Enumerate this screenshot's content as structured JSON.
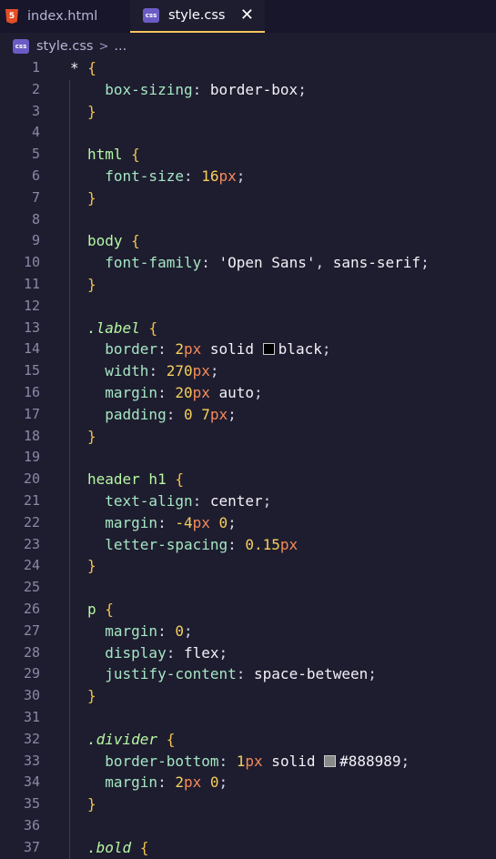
{
  "tabs": [
    {
      "label": "index.html",
      "icon": "html5-icon",
      "active": false
    },
    {
      "label": "style.css",
      "icon": "css-icon",
      "active": true
    }
  ],
  "tab_icon_text": {
    "html": "5",
    "css": "css"
  },
  "close_glyph": "✕",
  "breadcrumb": {
    "file": "style.css",
    "separator": ">",
    "more": "..."
  },
  "colors": {
    "editor_bg": "#1e1d2f",
    "tabbar_bg": "#17162a",
    "active_tab_border": "#f5c55b",
    "selector": "#b6f7a3",
    "brace": "#f2c14e",
    "property": "#a5e6c3",
    "number": "#f7cf5a",
    "unit": "#f58a5a",
    "line_number": "#8a88a8"
  },
  "lines": [
    {
      "n": "1",
      "tokens": [
        [
          "star",
          "* "
        ],
        [
          "brace",
          "{"
        ]
      ]
    },
    {
      "n": "2",
      "tokens": [
        [
          "prop",
          "  box-sizing"
        ],
        [
          "punct",
          ": "
        ],
        [
          "val",
          "border-box"
        ],
        [
          "punct",
          ";"
        ]
      ]
    },
    {
      "n": "3",
      "tokens": [
        [
          "brace",
          "}"
        ]
      ]
    },
    {
      "n": "4",
      "tokens": []
    },
    {
      "n": "5",
      "tokens": [
        [
          "tag",
          "html "
        ],
        [
          "brace",
          "{"
        ]
      ]
    },
    {
      "n": "6",
      "tokens": [
        [
          "prop",
          "  font-size"
        ],
        [
          "punct",
          ": "
        ],
        [
          "num",
          "16"
        ],
        [
          "unit",
          "px"
        ],
        [
          "punct",
          ";"
        ]
      ]
    },
    {
      "n": "7",
      "tokens": [
        [
          "brace",
          "}"
        ]
      ]
    },
    {
      "n": "8",
      "tokens": []
    },
    {
      "n": "9",
      "tokens": [
        [
          "tag",
          "body "
        ],
        [
          "brace",
          "{"
        ]
      ]
    },
    {
      "n": "10",
      "tokens": [
        [
          "prop",
          "  font-family"
        ],
        [
          "punct",
          ": "
        ],
        [
          "str",
          "'Open Sans'"
        ],
        [
          "punct",
          ", "
        ],
        [
          "val",
          "sans-serif"
        ],
        [
          "punct",
          ";"
        ]
      ]
    },
    {
      "n": "11",
      "tokens": [
        [
          "brace",
          "}"
        ]
      ]
    },
    {
      "n": "12",
      "tokens": []
    },
    {
      "n": "13",
      "tokens": [
        [
          "class",
          ".label"
        ],
        [
          "punct",
          " "
        ],
        [
          "brace",
          "{"
        ]
      ]
    },
    {
      "n": "14",
      "tokens": [
        [
          "prop",
          "  border"
        ],
        [
          "punct",
          ": "
        ],
        [
          "num",
          "2"
        ],
        [
          "unit",
          "px"
        ],
        [
          "val",
          " solid "
        ],
        [
          "swatch",
          "#000000"
        ],
        [
          "val",
          "black"
        ],
        [
          "punct",
          ";"
        ]
      ]
    },
    {
      "n": "15",
      "tokens": [
        [
          "prop",
          "  width"
        ],
        [
          "punct",
          ": "
        ],
        [
          "num",
          "270"
        ],
        [
          "unit",
          "px"
        ],
        [
          "punct",
          ";"
        ]
      ]
    },
    {
      "n": "16",
      "tokens": [
        [
          "prop",
          "  margin"
        ],
        [
          "punct",
          ": "
        ],
        [
          "num",
          "20"
        ],
        [
          "unit",
          "px"
        ],
        [
          "val",
          " auto"
        ],
        [
          "punct",
          ";"
        ]
      ]
    },
    {
      "n": "17",
      "tokens": [
        [
          "prop",
          "  padding"
        ],
        [
          "punct",
          ": "
        ],
        [
          "num",
          "0"
        ],
        [
          "punct",
          " "
        ],
        [
          "num",
          "7"
        ],
        [
          "unit",
          "px"
        ],
        [
          "punct",
          ";"
        ]
      ]
    },
    {
      "n": "18",
      "tokens": [
        [
          "brace",
          "}"
        ]
      ]
    },
    {
      "n": "19",
      "tokens": []
    },
    {
      "n": "20",
      "tokens": [
        [
          "tag",
          "header h1 "
        ],
        [
          "brace",
          "{"
        ]
      ]
    },
    {
      "n": "21",
      "tokens": [
        [
          "prop",
          "  text-align"
        ],
        [
          "punct",
          ": "
        ],
        [
          "val",
          "center"
        ],
        [
          "punct",
          ";"
        ]
      ]
    },
    {
      "n": "22",
      "tokens": [
        [
          "prop",
          "  margin"
        ],
        [
          "punct",
          ": "
        ],
        [
          "num",
          "-4"
        ],
        [
          "unit",
          "px"
        ],
        [
          "punct",
          " "
        ],
        [
          "num",
          "0"
        ],
        [
          "punct",
          ";"
        ]
      ]
    },
    {
      "n": "23",
      "tokens": [
        [
          "prop",
          "  letter-spacing"
        ],
        [
          "punct",
          ": "
        ],
        [
          "num",
          "0.15"
        ],
        [
          "unit",
          "px"
        ]
      ]
    },
    {
      "n": "24",
      "tokens": [
        [
          "brace",
          "}"
        ]
      ]
    },
    {
      "n": "25",
      "tokens": []
    },
    {
      "n": "26",
      "tokens": [
        [
          "tag",
          "p "
        ],
        [
          "brace",
          "{"
        ]
      ]
    },
    {
      "n": "27",
      "tokens": [
        [
          "prop",
          "  margin"
        ],
        [
          "punct",
          ": "
        ],
        [
          "num",
          "0"
        ],
        [
          "punct",
          ";"
        ]
      ]
    },
    {
      "n": "28",
      "tokens": [
        [
          "prop",
          "  display"
        ],
        [
          "punct",
          ": "
        ],
        [
          "val",
          "flex"
        ],
        [
          "punct",
          ";"
        ]
      ]
    },
    {
      "n": "29",
      "tokens": [
        [
          "prop",
          "  justify-content"
        ],
        [
          "punct",
          ": "
        ],
        [
          "val",
          "space-between"
        ],
        [
          "punct",
          ";"
        ]
      ]
    },
    {
      "n": "30",
      "tokens": [
        [
          "brace",
          "}"
        ]
      ]
    },
    {
      "n": "31",
      "tokens": []
    },
    {
      "n": "32",
      "tokens": [
        [
          "class",
          ".divider"
        ],
        [
          "punct",
          " "
        ],
        [
          "brace",
          "{"
        ]
      ]
    },
    {
      "n": "33",
      "tokens": [
        [
          "prop",
          "  border-bottom"
        ],
        [
          "punct",
          ": "
        ],
        [
          "num",
          "1"
        ],
        [
          "unit",
          "px"
        ],
        [
          "val",
          " solid "
        ],
        [
          "swatch",
          "#888989"
        ],
        [
          "val",
          "#888989"
        ],
        [
          "punct",
          ";"
        ]
      ]
    },
    {
      "n": "34",
      "tokens": [
        [
          "prop",
          "  margin"
        ],
        [
          "punct",
          ": "
        ],
        [
          "num",
          "2"
        ],
        [
          "unit",
          "px"
        ],
        [
          "punct",
          " "
        ],
        [
          "num",
          "0"
        ],
        [
          "punct",
          ";"
        ]
      ]
    },
    {
      "n": "35",
      "tokens": [
        [
          "brace",
          "}"
        ]
      ]
    },
    {
      "n": "36",
      "tokens": []
    },
    {
      "n": "37",
      "tokens": [
        [
          "class",
          ".bold"
        ],
        [
          "punct",
          " "
        ],
        [
          "brace",
          "{"
        ]
      ]
    }
  ]
}
